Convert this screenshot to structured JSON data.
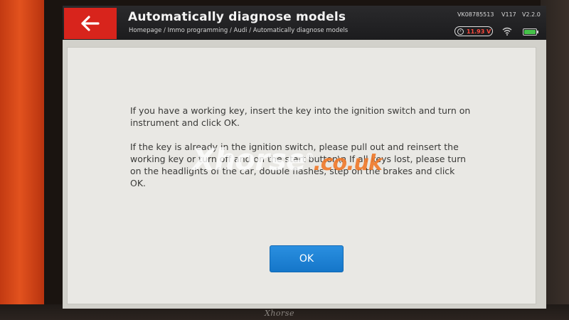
{
  "device": {
    "brand_logo": "Xhorse"
  },
  "header": {
    "title": "Automatically diagnose models",
    "breadcrumb": "Homepage / Immo programming / Audi / Automatically diagnose models",
    "serial": "VK08785513",
    "hardware_version": "V117",
    "software_version": "V2.2.0",
    "voltage": "11.93 V",
    "icons": {
      "back": "left-arrow-icon",
      "voltage": "voltage-gauge-icon",
      "wifi": "wifi-icon",
      "battery": "battery-icon"
    },
    "colors": {
      "back_button": "#d8241c",
      "voltage_text": "#ff4a3e",
      "battery_fill": "#46c34a"
    }
  },
  "dialog": {
    "paragraph_1": "If you have a  working key, insert the key into the ignition switch and turn on instrument and click OK.",
    "paragraph_2": "If the key is already in the ignition switch, please pull out and reinsert the working key or turn off and on the start button\\n If all keys lost, please turn on the headlights of the car, double flashes, step on the brakes and click OK.",
    "ok_label": "OK",
    "ok_color": "#1a7fd4"
  },
  "watermark": {
    "main": "Xhorse",
    "reg": "®",
    "domain": ".co.uk"
  }
}
